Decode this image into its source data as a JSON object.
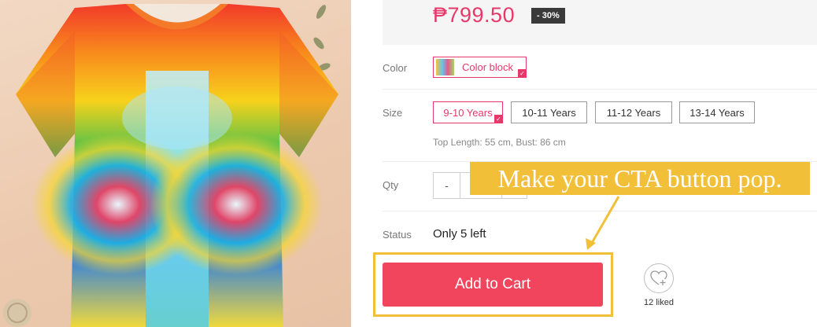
{
  "product": {
    "image_alt": "Tie-dye rainbow t-shirt"
  },
  "price": {
    "amount": "₱799.50",
    "discount": "- 30%"
  },
  "color": {
    "label": "Color",
    "selected": "Color block"
  },
  "size": {
    "label": "Size",
    "options": [
      "9-10 Years",
      "10-11 Years",
      "11-12 Years",
      "13-14 Years"
    ],
    "selected_index": 0,
    "note": "Top Length: 55 cm, Bust: 86 cm"
  },
  "qty": {
    "label": "Qty",
    "minus": "-"
  },
  "status": {
    "label": "Status",
    "value": "Only 5 left"
  },
  "actions": {
    "add_to_cart": "Add to Cart",
    "likes": "12 liked"
  },
  "annotation": {
    "callout": "Make your CTA button pop."
  },
  "colors": {
    "accent": "#e8386b",
    "cta": "#f1455e",
    "highlight": "#f1c038"
  },
  "icons": [
    "heart-plus-icon",
    "check-icon"
  ]
}
